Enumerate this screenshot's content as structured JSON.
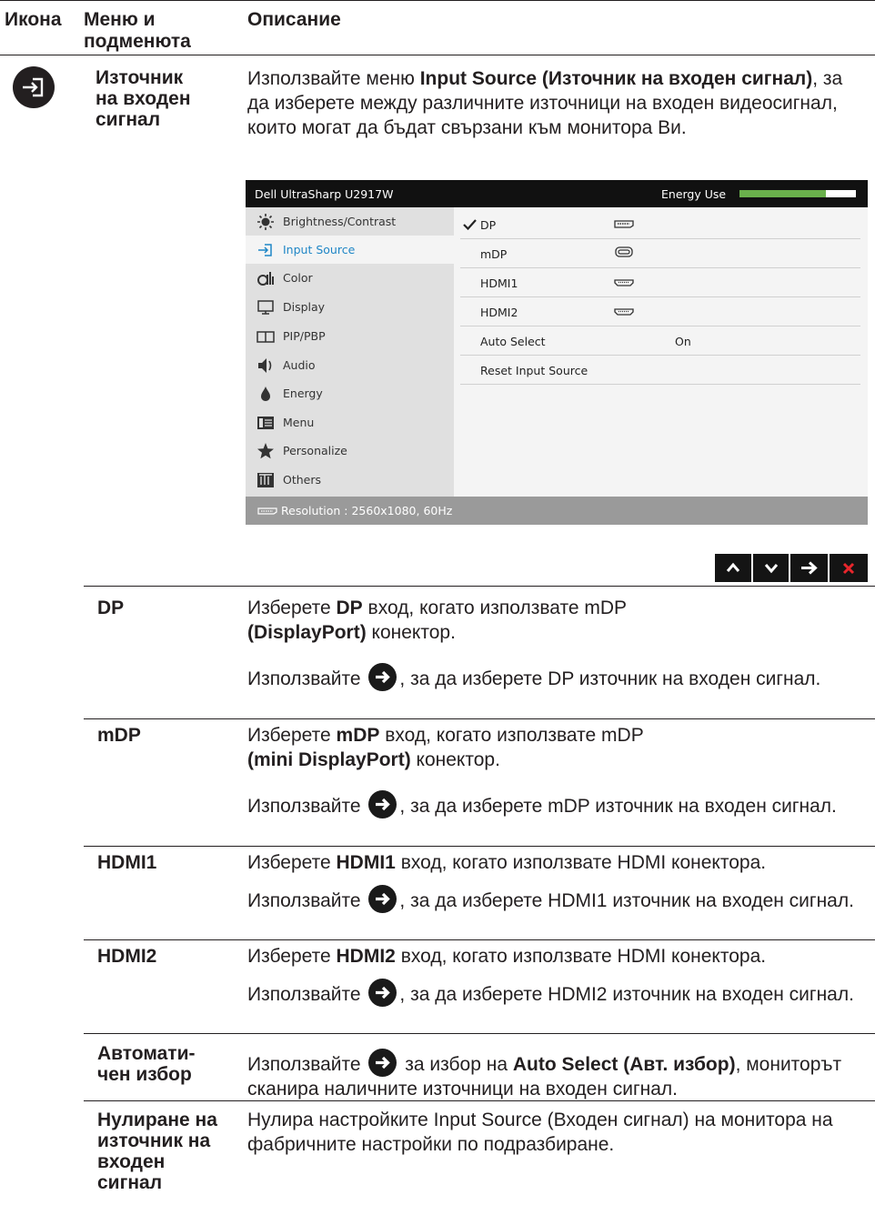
{
  "header": {
    "col_icon": "Икона",
    "col_menu": "Меню и подменюта",
    "col_desc": "Описание"
  },
  "main": {
    "label": "Източник на входен сигнал",
    "desc_pre": "Използвайте меню ",
    "desc_bold": "Input Source (Източник на входен сигнал)",
    "desc_post": ", за да изберете между различните източници на входен видеосигнал, които могат да бъдат свързани към монитора Ви."
  },
  "osd": {
    "title": "Dell UltraSharp U2917W",
    "energy_label": "Energy Use",
    "energy_level": 0.74,
    "menu": [
      "Brightness/Contrast",
      "Input Source",
      "Color",
      "Display",
      "PIP/PBP",
      "Audio",
      "Energy",
      "Menu",
      "Personalize",
      "Others"
    ],
    "menu_icons": [
      "brightness-icon",
      "input-source-icon",
      "color-icon",
      "display-icon",
      "pip-pbp-icon",
      "audio-icon",
      "energy-icon",
      "menu-icon",
      "personalize-icon",
      "others-icon"
    ],
    "selected_menu": "Input Source",
    "options": [
      "DP",
      "mDP",
      "HDMI1",
      "HDMI2",
      "Auto Select",
      "Reset Input Source"
    ],
    "checked_option": "DP",
    "auto_select_value": "On",
    "footer": "Resolution : 2560x1080, 60Hz",
    "accent": "#1f86c6",
    "energy_color": "#6ab04c"
  },
  "nav_buttons": [
    "up-icon",
    "down-icon",
    "right-arrow-icon",
    "close-icon"
  ],
  "rows": [
    {
      "label": "DP",
      "a_pre": "Изберете ",
      "a_bold": "DP",
      "a_mid": " вход, когато използвате mDP ",
      "a_bold2": "(DisplayPort)",
      "a_post": " конектор.",
      "b_pre": "Използвайте ",
      "b_post": ", за да изберете DP източник на входен сигнал."
    },
    {
      "label": "mDP",
      "a_pre": "Изберете ",
      "a_bold": "mDP",
      "a_mid": " вход, когато използвате mDP ",
      "a_bold2": "(mini DisplayPort)",
      "a_post": " конектор.",
      "b_pre": "Използвайте ",
      "b_post": ", за да изберете mDP източник на входен сигнал."
    },
    {
      "label": "HDMI1",
      "a_pre": "Изберете ",
      "a_bold": "HDMI1",
      "a_post": " вход, когато използвате HDMI конектора.",
      "b_pre": "Използвайте ",
      "b_post": ", за да изберете HDMI1 източник на входен сигнал."
    },
    {
      "label": "HDMI2",
      "a_pre": "Изберете ",
      "a_bold": "HDMI2",
      "a_post": " вход, когато използвате HDMI конектора.",
      "b_pre": "Използвайте ",
      "b_post": ", за да изберете HDMI2 източник на входен сигнал."
    },
    {
      "label": "Автомати-чен избор",
      "a_pre": "Използвайте ",
      "a_mid": " за избор на ",
      "a_bold": "Auto Select (Авт. избор)",
      "a_post": ", мониторът сканира наличните източници на входен сигнал."
    },
    {
      "label": "Нулиране на източник на входен сигнал",
      "a_pre": "Нулира настройките Input Source (Входен сигнал) на монитора на фабричните настройки по подразбиране."
    }
  ]
}
